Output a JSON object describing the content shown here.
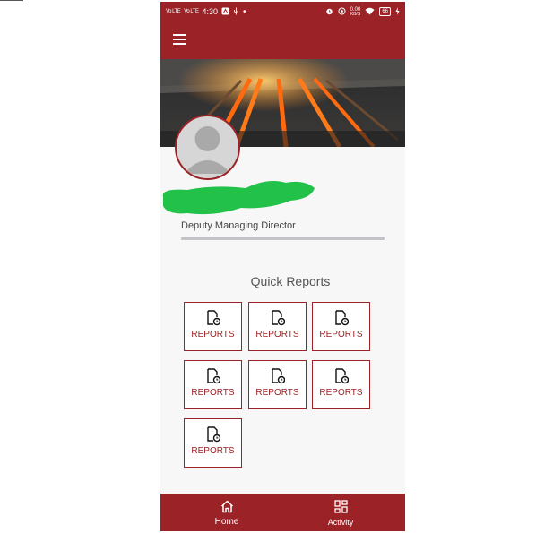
{
  "status_bar": {
    "time": "4:30",
    "signal_1": "Vo LTE",
    "signal_2": "Vo LTE",
    "data_speed": "0.00",
    "data_unit": "KB/S",
    "battery": "66",
    "icons": [
      "signal-icon",
      "signal-icon",
      "notification-icon",
      "usb-icon",
      "alarm-icon",
      "wifi-icon",
      "battery-icon",
      "charging-icon"
    ]
  },
  "header": {
    "menu_icon": "hamburger-menu-icon"
  },
  "profile": {
    "designation": "Deputy Managing Director",
    "avatar_icon": "user-avatar-icon"
  },
  "quick_reports": {
    "title": "Quick Reports",
    "tiles": [
      {
        "label": "REPORTS",
        "icon": "report-file-icon"
      },
      {
        "label": "REPORTS",
        "icon": "report-file-icon"
      },
      {
        "label": "REPORTS",
        "icon": "report-file-icon"
      },
      {
        "label": "REPORTS",
        "icon": "report-file-icon"
      },
      {
        "label": "REPORTS",
        "icon": "report-file-icon"
      },
      {
        "label": "REPORTS",
        "icon": "report-file-icon"
      },
      {
        "label": "REPORTS",
        "icon": "report-file-icon"
      }
    ]
  },
  "bottom_nav": {
    "home_label": "Home",
    "activity_label": "Activity"
  },
  "colors": {
    "primary": "#9b2226",
    "background": "#f7f7f7",
    "redaction": "#22c24a"
  }
}
